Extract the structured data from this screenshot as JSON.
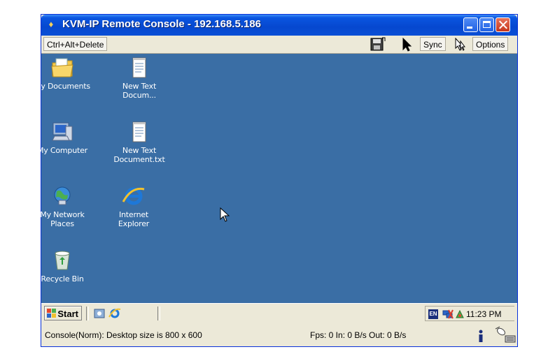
{
  "window": {
    "title": "KVM-IP Remote Console - 192.168.5.186"
  },
  "toolbar": {
    "ctrl_alt_delete": "Ctrl+Alt+Delete",
    "sync": "Sync",
    "options": "Options"
  },
  "desktop": {
    "icons": [
      {
        "label": "My Documents",
        "icon": "my-documents-icon"
      },
      {
        "label": "New Text Docum...",
        "icon": "text-document-icon"
      },
      {
        "label": "My Computer",
        "icon": "my-computer-icon"
      },
      {
        "label": "New Text Document.txt",
        "icon": "text-document-icon"
      },
      {
        "label": "My Network Places",
        "icon": "network-places-icon"
      },
      {
        "label": "Internet Explorer",
        "icon": "internet-explorer-icon"
      },
      {
        "label": "Recycle Bin",
        "icon": "recycle-bin-icon"
      }
    ]
  },
  "taskbar": {
    "start": "Start",
    "lang": "EN",
    "clock": "11:23 PM"
  },
  "statusbar": {
    "left": "Console(Norm): Desktop size is 800 x 600",
    "middle": "Fps: 0 In: 0 B/s Out: 0 B/s"
  }
}
